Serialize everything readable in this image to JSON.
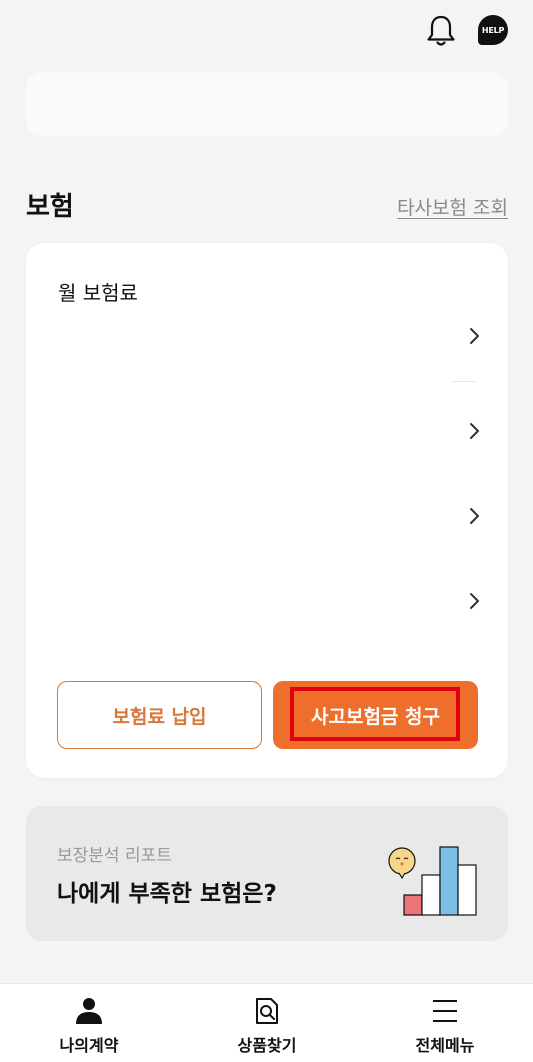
{
  "header": {
    "help_label": "HELP",
    "bell_icon": "bell-icon",
    "help_icon": "help-bubble-icon"
  },
  "insurance": {
    "section_title": "보험",
    "other_insurance_link": "타사보험 조회",
    "monthly_premium_label": "월 보험료",
    "pay_button": "보험료 납입",
    "claim_button": "사고보험금 청구",
    "accent_color": "#ed6f2b"
  },
  "report": {
    "subtitle": "보장분석 리포트",
    "title": "나에게 부족한 보험은?"
  },
  "bottom_nav": {
    "items": [
      {
        "label": "나의계약",
        "icon": "person-icon"
      },
      {
        "label": "상품찾기",
        "icon": "search-document-icon"
      },
      {
        "label": "전체메뉴",
        "icon": "menu-icon"
      }
    ]
  }
}
